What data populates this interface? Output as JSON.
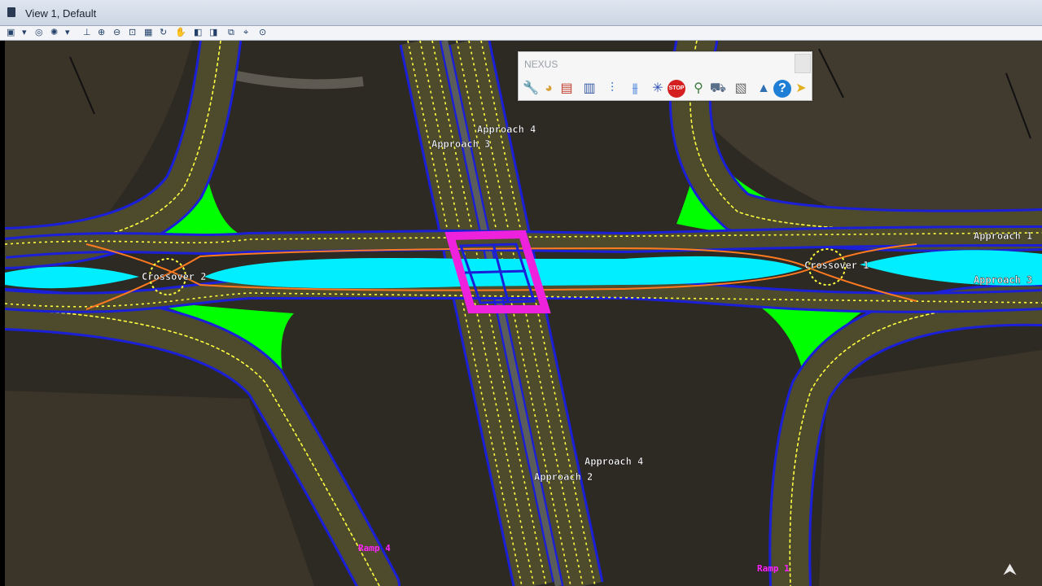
{
  "window": {
    "title": "View 1, Default"
  },
  "toolbar": {
    "tools": [
      {
        "name": "view-attributes-icon",
        "glyph": "▣"
      },
      {
        "name": "dropdown-arrow-icon",
        "glyph": "▾"
      },
      {
        "name": "display-style-icon",
        "glyph": "◎"
      },
      {
        "name": "lighting-icon",
        "glyph": "✺"
      },
      {
        "name": "dropdown-arrow-icon-2",
        "glyph": "▾"
      },
      {
        "name": "level-display-icon",
        "glyph": "⊥"
      },
      {
        "name": "zoom-in-icon",
        "glyph": "⊕"
      },
      {
        "name": "zoom-out-icon",
        "glyph": "⊖"
      },
      {
        "name": "window-area-icon",
        "glyph": "⊡"
      },
      {
        "name": "fit-view-icon",
        "glyph": "▦"
      },
      {
        "name": "rotate-view-icon",
        "glyph": "↻"
      },
      {
        "name": "pan-view-icon",
        "glyph": "✋"
      },
      {
        "name": "previous-view-icon",
        "glyph": "◧"
      },
      {
        "name": "next-view-icon",
        "glyph": "◨"
      },
      {
        "name": "copy-view-icon",
        "glyph": "⧉"
      },
      {
        "name": "camera-icon",
        "glyph": "⌖"
      },
      {
        "name": "view-settings-icon",
        "glyph": "⊙"
      }
    ]
  },
  "nexus_panel": {
    "title": "NEXUS",
    "tools": [
      {
        "name": "wrench-icon",
        "glyph": "🔧",
        "color": "#c78a1a"
      },
      {
        "name": "palette-icon",
        "glyph": "◕",
        "color": "#d8a23a"
      },
      {
        "name": "printer-icon",
        "glyph": "▤",
        "color": "#c0392b"
      },
      {
        "name": "document-icon",
        "glyph": "▥",
        "color": "#3b5ea8"
      },
      {
        "name": "split-lanes-icon",
        "glyph": "⫶",
        "color": "#2a6fd6"
      },
      {
        "name": "merge-lanes-icon",
        "glyph": "⫵",
        "color": "#2a6fd6"
      },
      {
        "name": "intersection-icon",
        "glyph": "✳",
        "color": "#2a4fb8"
      },
      {
        "name": "stop-sign-icon",
        "glyph": "STOP",
        "color": "#d42020"
      },
      {
        "name": "signal-pole-icon",
        "glyph": "⚲",
        "color": "#3d7a3d"
      },
      {
        "name": "truck-icon",
        "glyph": "⛟",
        "color": "#5a6f8a"
      },
      {
        "name": "report-icon",
        "glyph": "▧",
        "color": "#6a6a6a"
      },
      {
        "name": "education-cap-icon",
        "glyph": "▲",
        "color": "#2f6fb3"
      },
      {
        "name": "help-icon",
        "glyph": "?",
        "color": "#1f7fd6"
      },
      {
        "name": "exit-arrow-icon",
        "glyph": "➤",
        "color": "#e0b020"
      }
    ]
  },
  "map": {
    "colors": {
      "road_edge": "#1b1fd8",
      "pavement": "#4d4b2c",
      "lane_marking": "#ffff40",
      "island_green": "#00ff00",
      "median_cyan": "#00eeff",
      "bridge_magenta": "#ee22dd",
      "centerline_orange": "#ff7a20",
      "terrain": "#2d2923"
    },
    "labels": {
      "approach4_top": "Approach 4",
      "approach3_top": "Approach 3",
      "approach4_bottom": "Approach 4",
      "approach2_bottom": "Approach 2",
      "approach1_right": "Approach 1",
      "approach3_right": "Approach 3",
      "crossover1": "Crossover 1",
      "crossover2": "Crossover 2",
      "ramp_bottom_left": "Ramp 4",
      "ramp_bottom_right": "Ramp 1"
    }
  }
}
